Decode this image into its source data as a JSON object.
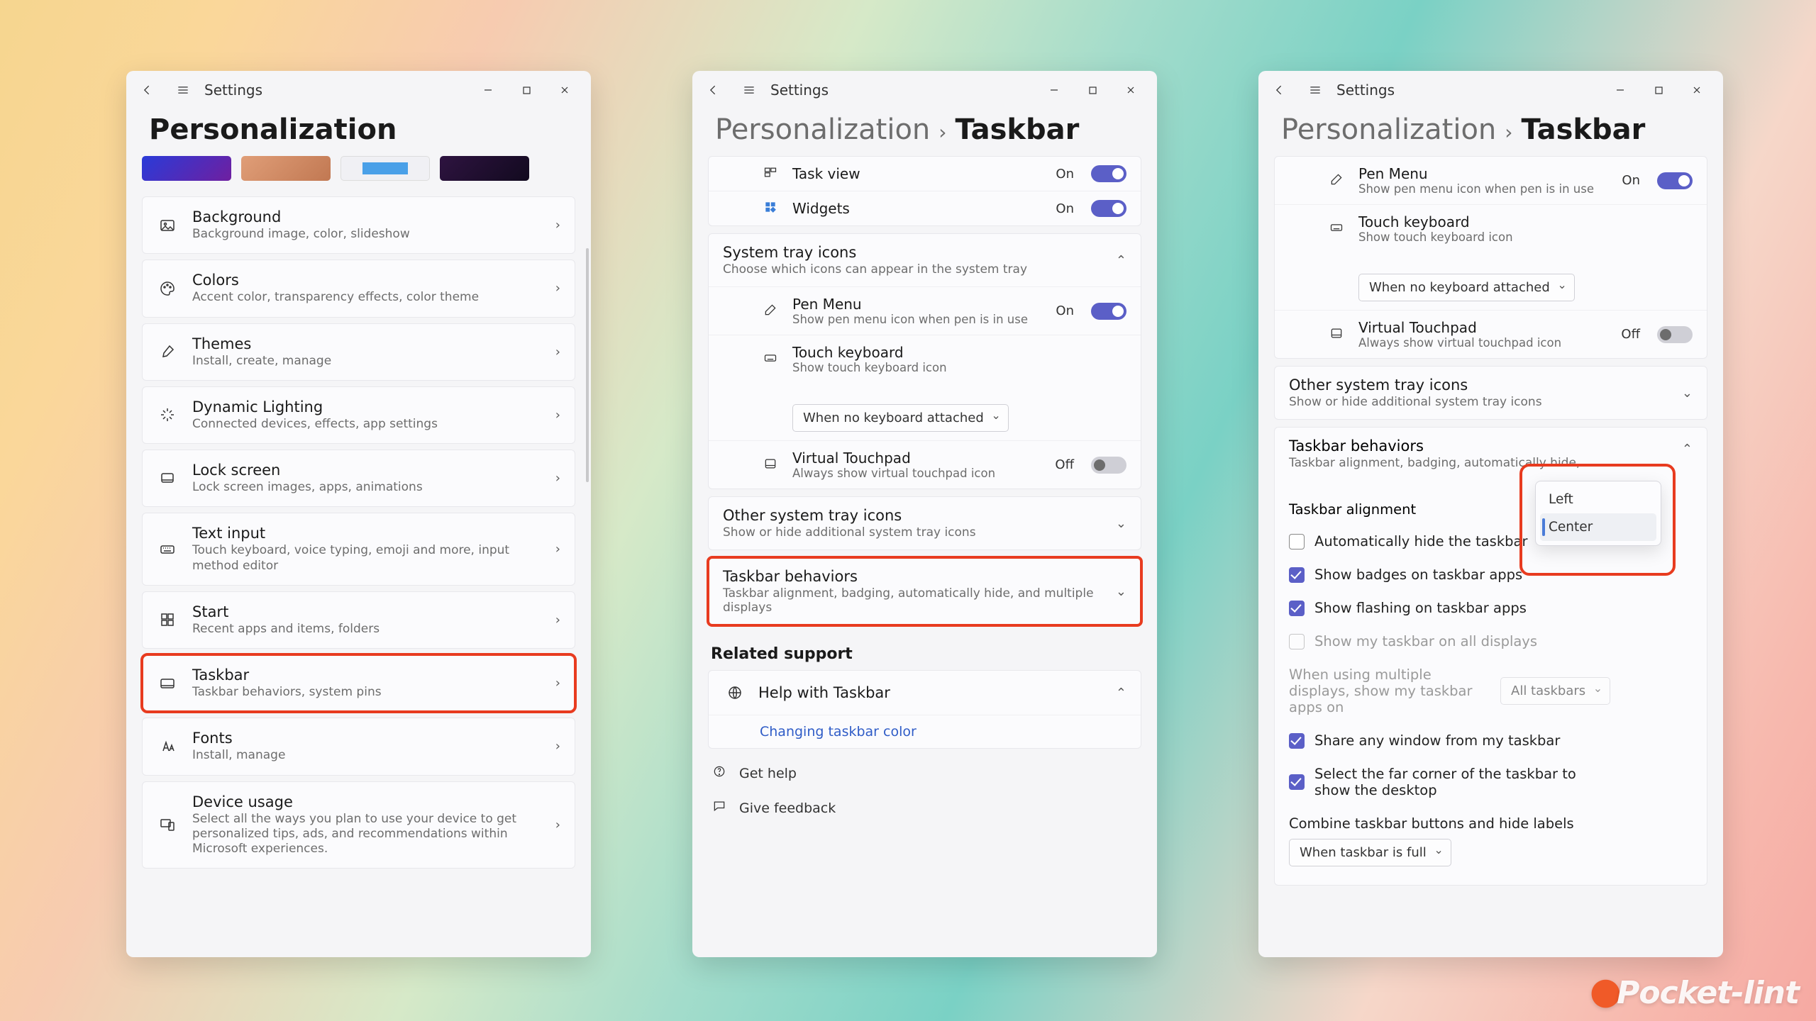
{
  "watermark": "Pocket-lint",
  "common": {
    "app_title": "Settings",
    "win_min": "—",
    "win_max": "▢",
    "win_close": "✕",
    "chevron_right": "›",
    "chevron_down": "⌄",
    "chevron_up": "⌃"
  },
  "w1": {
    "header": "Personalization",
    "items": [
      {
        "title": "Background",
        "sub": "Background image, color, slideshow"
      },
      {
        "title": "Colors",
        "sub": "Accent color, transparency effects, color theme"
      },
      {
        "title": "Themes",
        "sub": "Install, create, manage"
      },
      {
        "title": "Dynamic Lighting",
        "sub": "Connected devices, effects, app settings"
      },
      {
        "title": "Lock screen",
        "sub": "Lock screen images, apps, animations"
      },
      {
        "title": "Text input",
        "sub": "Touch keyboard, voice typing, emoji and more, input method editor"
      },
      {
        "title": "Start",
        "sub": "Recent apps and items, folders"
      },
      {
        "title": "Taskbar",
        "sub": "Taskbar behaviors, system pins"
      },
      {
        "title": "Fonts",
        "sub": "Install, manage"
      },
      {
        "title": "Device usage",
        "sub": "Select all the ways you plan to use your device to get personalized tips, ads, and recommendations within Microsoft experiences."
      }
    ]
  },
  "w2": {
    "breadcrumb_root": "Personalization",
    "breadcrumb_leaf": "Taskbar",
    "tb_items": [
      {
        "title": "Task view",
        "state": "On",
        "on": true
      },
      {
        "title": "Widgets",
        "state": "On",
        "on": true
      }
    ],
    "systray": {
      "title": "System tray icons",
      "sub": "Choose which icons can appear in the system tray",
      "rows": [
        {
          "title": "Pen Menu",
          "sub": "Show pen menu icon when pen is in use",
          "state": "On",
          "on": true,
          "type": "toggle"
        },
        {
          "title": "Touch keyboard",
          "sub": "Show touch keyboard icon",
          "type": "dropdown",
          "value": "When no keyboard attached"
        },
        {
          "title": "Virtual Touchpad",
          "sub": "Always show virtual touchpad icon",
          "state": "Off",
          "on": false,
          "type": "toggle"
        }
      ]
    },
    "other_tray": {
      "title": "Other system tray icons",
      "sub": "Show or hide additional system tray icons"
    },
    "behaviors": {
      "title": "Taskbar behaviors",
      "sub": "Taskbar alignment, badging, automatically hide, and multiple displays"
    },
    "related": "Related support",
    "help": "Help with Taskbar",
    "help_link": "Changing taskbar color",
    "get_help": "Get help",
    "feedback": "Give feedback"
  },
  "w3": {
    "breadcrumb_root": "Personalization",
    "breadcrumb_leaf": "Taskbar",
    "systray_rows": [
      {
        "title": "Pen Menu",
        "sub": "Show pen menu icon when pen is in use",
        "state": "On",
        "on": true,
        "type": "toggle"
      },
      {
        "title": "Touch keyboard",
        "sub": "Show touch keyboard icon",
        "type": "dropdown",
        "value": "When no keyboard attached"
      },
      {
        "title": "Virtual Touchpad",
        "sub": "Always show virtual touchpad icon",
        "state": "Off",
        "on": false,
        "type": "toggle"
      }
    ],
    "other_tray": {
      "title": "Other system tray icons",
      "sub": "Show or hide additional system tray icons"
    },
    "behav": {
      "title": "Taskbar behaviors",
      "sub": "Taskbar alignment, badging, automatically hide,"
    },
    "align_label": "Taskbar alignment",
    "align_options": [
      "Left",
      "Center"
    ],
    "align_selected": "Center",
    "checks": [
      {
        "label": "Automatically hide the taskbar",
        "checked": false,
        "disabled": false
      },
      {
        "label": "Show badges on taskbar apps",
        "checked": true,
        "disabled": false
      },
      {
        "label": "Show flashing on taskbar apps",
        "checked": true,
        "disabled": false
      },
      {
        "label": "Show my taskbar on all displays",
        "checked": false,
        "disabled": true
      }
    ],
    "multi_label": "When using multiple displays, show my taskbar apps on",
    "multi_value": "All taskbars",
    "checks2": [
      {
        "label": "Share any window from my taskbar",
        "checked": true
      },
      {
        "label": "Select the far corner of the taskbar to show the desktop",
        "checked": true
      }
    ],
    "combine_label": "Combine taskbar buttons and hide labels",
    "combine_value": "When taskbar is full"
  }
}
